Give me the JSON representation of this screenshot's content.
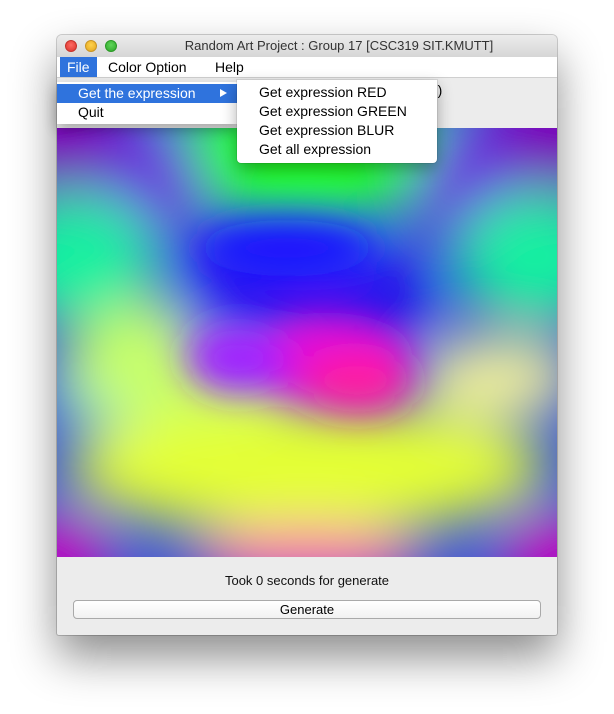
{
  "window": {
    "title": "Random Art Project : Group 17 [CSC319 SIT.KMUTT]"
  },
  "menubar": {
    "items": [
      {
        "label": "File"
      },
      {
        "label": "Color Option"
      },
      {
        "label": "Help"
      }
    ]
  },
  "file_menu": {
    "items": [
      {
        "label": "Get the expression"
      },
      {
        "label": "Quit"
      }
    ]
  },
  "expression_submenu": {
    "items": [
      {
        "label": "Get expression RED"
      },
      {
        "label": "Get expression GREEN"
      },
      {
        "label": "Get expression BLUR"
      },
      {
        "label": "Get all expression"
      }
    ]
  },
  "strip": {
    "partial_text": "))"
  },
  "status": {
    "text": "Took 0 seconds for generate"
  },
  "actions": {
    "generate_label": "Generate"
  },
  "colors": {
    "menu_highlight": "#2f73dd",
    "window_bg": "#ececec"
  },
  "icons": [
    "close-window-icon",
    "minimize-window-icon",
    "maximize-window-icon",
    "submenu-arrow-icon"
  ]
}
